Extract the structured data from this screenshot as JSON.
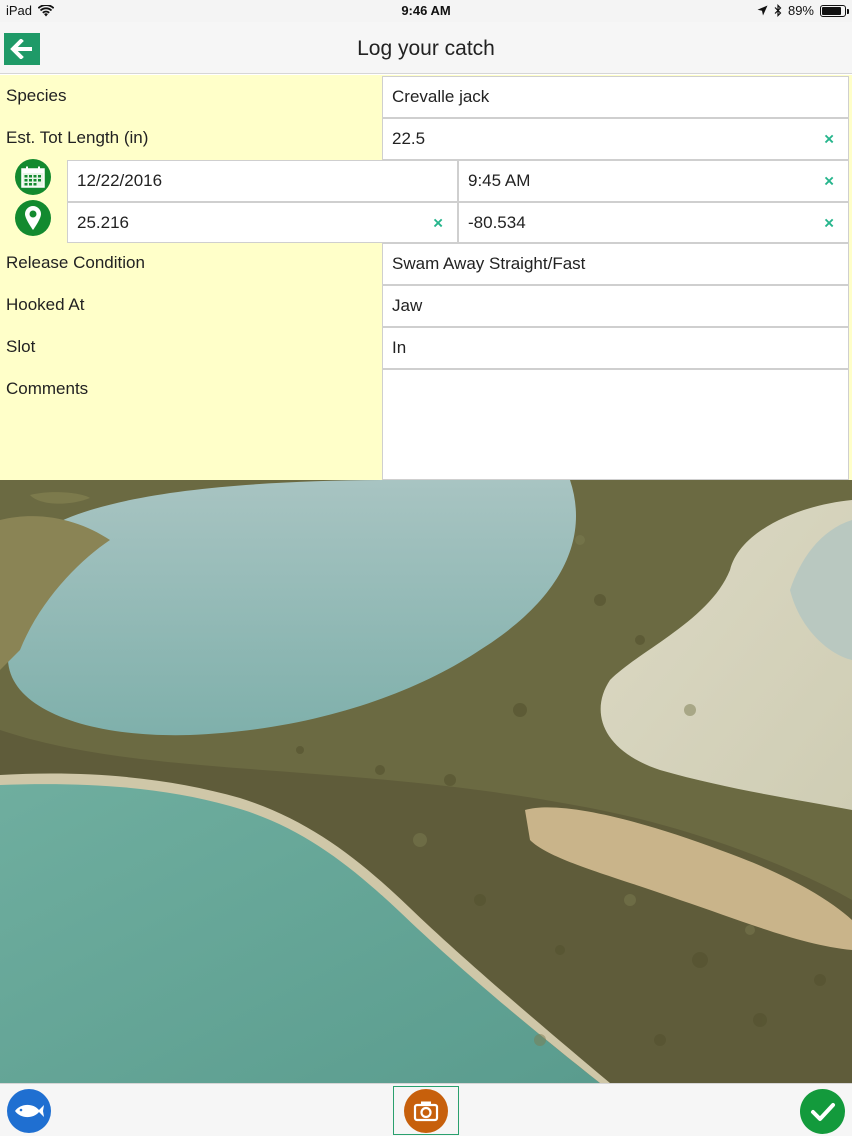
{
  "status_bar": {
    "device": "iPad",
    "time": "9:46 AM",
    "battery": "89%",
    "battery_level": 0.89
  },
  "nav": {
    "title": "Log your catch"
  },
  "form": {
    "species_label": "Species",
    "species_value": "Crevalle jack",
    "length_label": "Est. Tot Length (in)",
    "length_value": "22.5",
    "date_value": "12/22/2016",
    "time_value": "9:45 AM",
    "latitude_value": "25.216",
    "longitude_value": "-80.534",
    "release_label": "Release Condition",
    "release_value": "Swam Away Straight/Fast",
    "hooked_label": "Hooked At",
    "hooked_value": "Jaw",
    "slot_label": "Slot",
    "slot_value": "In",
    "comments_label": "Comments",
    "comments_value": "",
    "clear_glyph": "×"
  },
  "icons": {
    "back": "back-arrow-icon",
    "calendar": "calendar-icon",
    "location": "location-pin-icon",
    "fish": "fish-icon",
    "camera": "camera-icon",
    "confirm": "checkmark-icon"
  },
  "colors": {
    "accent_green": "#1f9a68",
    "form_background": "#ffffc9",
    "clear_icon": "#26b58c",
    "fish_button": "#1f6fd1",
    "camera_button": "#c7600c",
    "confirm_button": "#139a3c"
  }
}
